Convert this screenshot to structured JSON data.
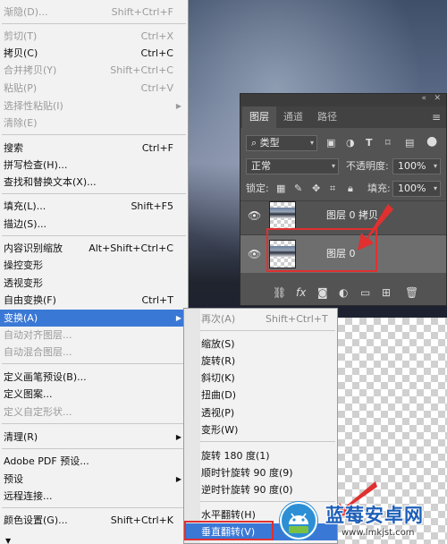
{
  "edit_menu": {
    "items": [
      {
        "label": "渐隐(D)...",
        "shortcut": "Shift+Ctrl+F",
        "disabled": true
      },
      {
        "label": "剪切(T)",
        "shortcut": "Ctrl+X",
        "disabled": true
      },
      {
        "label": "拷贝(C)",
        "shortcut": "Ctrl+C",
        "disabled": false
      },
      {
        "label": "合并拷贝(Y)",
        "shortcut": "Shift+Ctrl+C",
        "disabled": true
      },
      {
        "label": "粘贴(P)",
        "shortcut": "Ctrl+V",
        "disabled": true
      },
      {
        "label": "选择性粘贴(I)",
        "shortcut": "",
        "disabled": true
      },
      {
        "label": "清除(E)",
        "shortcut": "",
        "disabled": true
      },
      {
        "label": "搜索",
        "shortcut": "Ctrl+F",
        "disabled": false
      },
      {
        "label": "拼写检查(H)...",
        "shortcut": "",
        "disabled": false
      },
      {
        "label": "查找和替换文本(X)...",
        "shortcut": "",
        "disabled": false
      },
      {
        "label": "填充(L)...",
        "shortcut": "Shift+F5",
        "disabled": false
      },
      {
        "label": "描边(S)...",
        "shortcut": "",
        "disabled": false
      },
      {
        "label": "内容识别缩放",
        "shortcut": "Alt+Shift+Ctrl+C",
        "disabled": false
      },
      {
        "label": "操控变形",
        "shortcut": "",
        "disabled": false
      },
      {
        "label": "透视变形",
        "shortcut": "",
        "disabled": false
      },
      {
        "label": "自由变换(F)",
        "shortcut": "Ctrl+T",
        "disabled": false
      },
      {
        "label": "变换(A)",
        "shortcut": "",
        "disabled": false
      },
      {
        "label": "自动对齐图层...",
        "shortcut": "",
        "disabled": true
      },
      {
        "label": "自动混合图层...",
        "shortcut": "",
        "disabled": true
      },
      {
        "label": "定义画笔预设(B)...",
        "shortcut": "",
        "disabled": false
      },
      {
        "label": "定义图案...",
        "shortcut": "",
        "disabled": false
      },
      {
        "label": "定义自定形状...",
        "shortcut": "",
        "disabled": true
      },
      {
        "label": "清理(R)",
        "shortcut": "",
        "disabled": false
      },
      {
        "label": "Adobe PDF 预设...",
        "shortcut": "",
        "disabled": false
      },
      {
        "label": "预设",
        "shortcut": "",
        "disabled": false
      },
      {
        "label": "远程连接...",
        "shortcut": "",
        "disabled": false
      },
      {
        "label": "颜色设置(G)...",
        "shortcut": "Shift+Ctrl+K",
        "disabled": false
      }
    ],
    "highlighted": "变换(A)"
  },
  "transform_submenu": {
    "items": [
      {
        "label": "再次(A)",
        "shortcut": "Shift+Ctrl+T",
        "disabled": true
      },
      {
        "label": "缩放(S)",
        "shortcut": "",
        "disabled": false
      },
      {
        "label": "旋转(R)",
        "shortcut": "",
        "disabled": false
      },
      {
        "label": "斜切(K)",
        "shortcut": "",
        "disabled": false
      },
      {
        "label": "扭曲(D)",
        "shortcut": "",
        "disabled": false
      },
      {
        "label": "透视(P)",
        "shortcut": "",
        "disabled": false
      },
      {
        "label": "变形(W)",
        "shortcut": "",
        "disabled": false
      },
      {
        "label": "旋转 180 度(1)",
        "shortcut": "",
        "disabled": false
      },
      {
        "label": "顺时针旋转 90 度(9)",
        "shortcut": "",
        "disabled": false
      },
      {
        "label": "逆时针旋转 90 度(0)",
        "shortcut": "",
        "disabled": false
      },
      {
        "label": "水平翻转(H)",
        "shortcut": "",
        "disabled": false
      },
      {
        "label": "垂直翻转(V)",
        "shortcut": "",
        "disabled": false
      }
    ],
    "highlighted": "垂直翻转(V)"
  },
  "layers_panel": {
    "tabs": [
      "图层",
      "通道",
      "路径"
    ],
    "active_tab": "图层",
    "filter_label": "类型",
    "blend_mode": "正常",
    "opacity_label": "不透明度:",
    "opacity_value": "100%",
    "lock_label": "锁定:",
    "fill_label": "填充:",
    "fill_value": "100%",
    "layers": [
      {
        "name": "图层 0 拷贝",
        "visible": true,
        "selected": false
      },
      {
        "name": "图层 0",
        "visible": true,
        "selected": true
      }
    ]
  },
  "watermark": {
    "title": "蓝莓安卓网",
    "url": "www.lmkjst.com"
  },
  "colors": {
    "menu_highlight": "#3a78d6",
    "annotation_red": "#e03030",
    "panel_bg": "#535353"
  }
}
